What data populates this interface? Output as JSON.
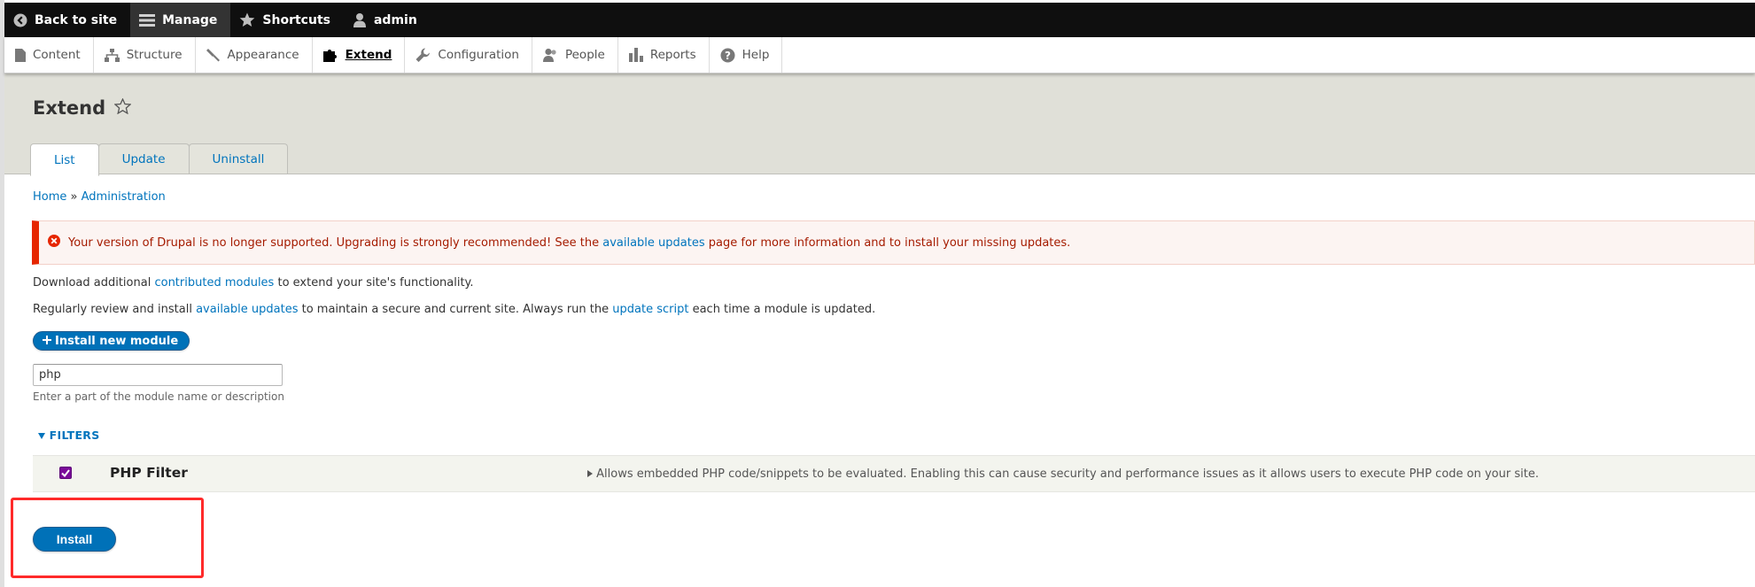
{
  "toolbar": {
    "back": "Back to site",
    "manage": "Manage",
    "shortcuts": "Shortcuts",
    "user": "admin"
  },
  "tray": {
    "items": [
      "Content",
      "Structure",
      "Appearance",
      "Extend",
      "Configuration",
      "People",
      "Reports",
      "Help"
    ]
  },
  "header": {
    "title": "Extend",
    "tabs": [
      "List",
      "Update",
      "Uninstall"
    ]
  },
  "breadcrumb": {
    "home": "Home",
    "sep": "»",
    "admin": "Administration"
  },
  "alert": {
    "before": "Your version of Drupal is no longer supported. Upgrading is strongly recommended! See the",
    "link": "available updates",
    "after": "page for more information and to install your missing updates."
  },
  "intro1": {
    "before": "Download additional",
    "link": "contributed modules",
    "after": "to extend your site's functionality."
  },
  "intro2": {
    "before": "Regularly review and install",
    "link1": "available updates",
    "middle": "to maintain a secure and current site. Always run the",
    "link2": "update script",
    "after": "each time a module is updated."
  },
  "install_new_label": "Install new module",
  "search": {
    "value": "php",
    "description": "Enter a part of the module name or description"
  },
  "filters_label": "FILTERS",
  "module": {
    "name": "PHP Filter",
    "checked": true,
    "description": "Allows embedded PHP code/snippets to be evaluated. Enabling this can cause security and performance issues as it allows users to execute PHP code on your site."
  },
  "install_label": "Install",
  "colors": {
    "toolbar_bg": "#0f0f0f",
    "link": "#0074bd",
    "button": "#0071b8",
    "error": "#e62600",
    "checkbox": "#7a0a99",
    "highlight": "#ff2a2a"
  }
}
